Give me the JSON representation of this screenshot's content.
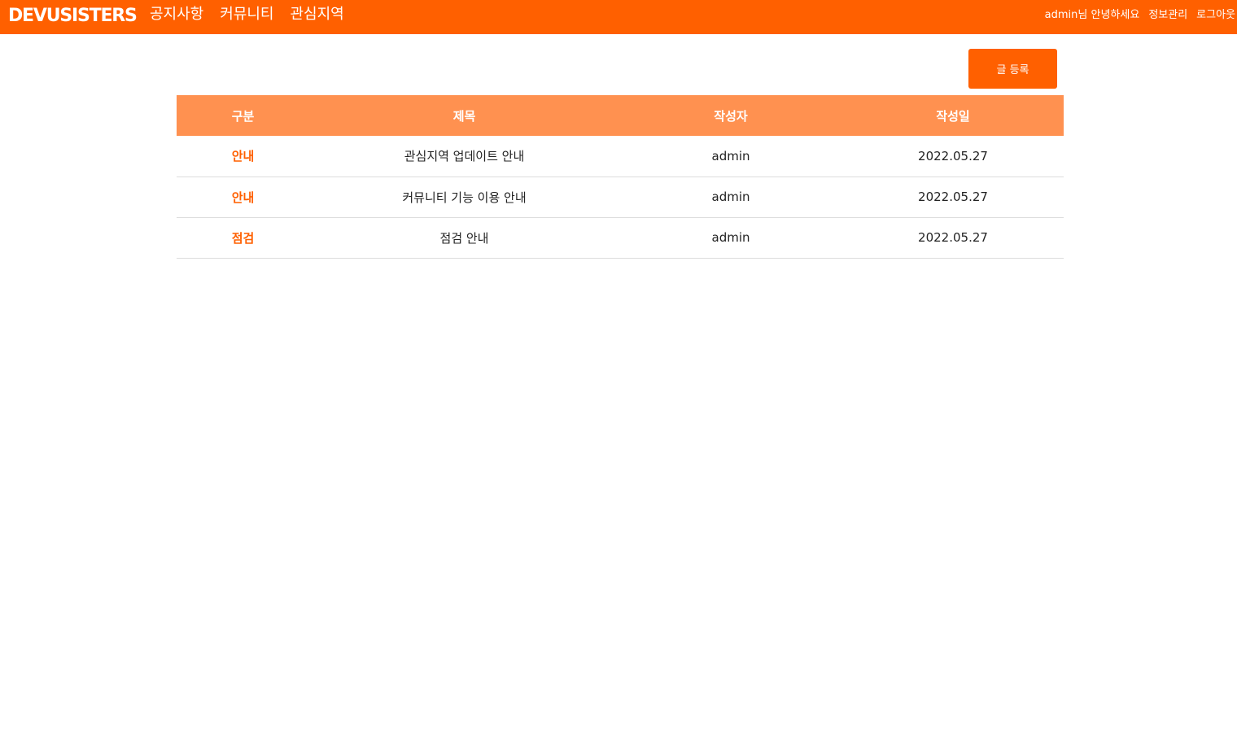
{
  "header": {
    "logo": "DEVUSISTERS",
    "menu": [
      {
        "label": "공지사항"
      },
      {
        "label": "커뮤니티"
      },
      {
        "label": "관심지역"
      }
    ],
    "greeting": "admin님 안녕하세요",
    "profile_link": "정보관리",
    "logout_link": "로그아웃"
  },
  "actions": {
    "write_label": "글 등록"
  },
  "table": {
    "columns": [
      "구분",
      "제목",
      "작성자",
      "작성일"
    ],
    "rows": [
      {
        "category": "안내",
        "title": "관심지역 업데이트 안내",
        "author": "admin",
        "date": "2022.05.27"
      },
      {
        "category": "안내",
        "title": "커뮤니티 기능 이용 안내",
        "author": "admin",
        "date": "2022.05.27"
      },
      {
        "category": "점검",
        "title": "점검 안내",
        "author": "admin",
        "date": "2022.05.27"
      }
    ]
  },
  "colors": {
    "brand": "#ff6000",
    "table_header": "#ff9150"
  }
}
